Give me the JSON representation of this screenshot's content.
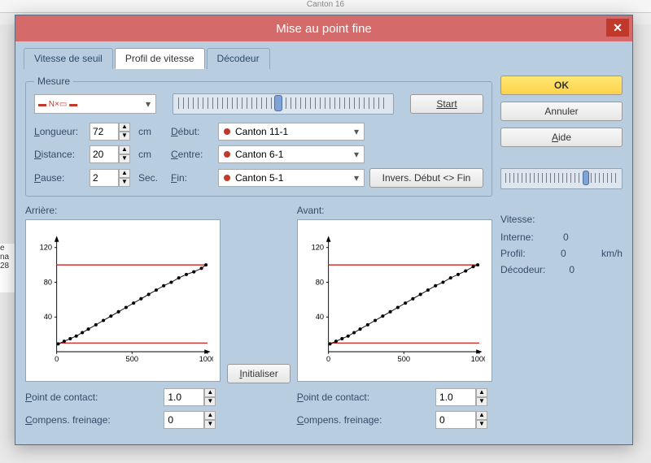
{
  "window": {
    "bg_title": "Canton 16"
  },
  "dialog": {
    "title": "Mise au point fine",
    "close_glyph": "✕",
    "tabs": {
      "threshold": "Vitesse de seuil",
      "profile": "Profil de vitesse",
      "decoder": "Décodeur"
    },
    "measure": {
      "legend": "Mesure",
      "start_btn": "Start",
      "longueur_lbl": "Longueur:",
      "longueur_val": "72",
      "cm": "cm",
      "distance_lbl": "Distance:",
      "distance_val": "20",
      "pause_lbl": "Pause:",
      "pause_val": "2",
      "sec": "Sec.",
      "debut_lbl": "Début:",
      "debut_val": "Canton 11-1",
      "centre_lbl": "Centre:",
      "centre_val": "Canton 6-1",
      "fin_lbl": "Fin:",
      "fin_val": "Canton 5-1",
      "invert_btn": "Invers. Début <> Fin"
    },
    "arriere": {
      "title": "Arrière:",
      "contact_lbl": "Point de contact:",
      "contact_val": "1.0",
      "compens_lbl": "Compens. freinage:",
      "compens_val": "0"
    },
    "avant": {
      "title": "Avant:",
      "contact_lbl": "Point de contact:",
      "contact_val": "1.0",
      "compens_lbl": "Compens. freinage:",
      "compens_val": "0"
    },
    "init_btn": "Initialiser",
    "right": {
      "ok": "OK",
      "annuler": "Annuler",
      "aide": "Aide",
      "vitesse_hdr": "Vitesse:",
      "interne_lbl": "Interne:",
      "interne_val": "0",
      "profil_lbl": "Profil:",
      "profil_val": "0",
      "profil_unit": "km/h",
      "decodeur_lbl": "Décodeur:",
      "decodeur_val": "0"
    }
  },
  "chart_data": [
    {
      "type": "line",
      "title": "Arrière",
      "xlabel": "",
      "ylabel": "",
      "xlim": [
        0,
        1000
      ],
      "ylim": [
        0,
        130
      ],
      "x_ticks": [
        0,
        500,
        1000
      ],
      "y_ticks": [
        40,
        80,
        120
      ],
      "hlines": [
        10,
        100
      ],
      "series": [
        {
          "name": "profile",
          "x": [
            10,
            50,
            90,
            130,
            170,
            210,
            260,
            310,
            360,
            410,
            460,
            510,
            560,
            610,
            660,
            710,
            760,
            810,
            860,
            910,
            960,
            990
          ],
          "y": [
            9,
            12,
            15,
            18,
            22,
            26,
            31,
            36,
            41,
            46,
            51,
            56,
            61,
            66,
            71,
            76,
            80,
            85,
            89,
            92,
            96,
            100
          ]
        }
      ]
    },
    {
      "type": "line",
      "title": "Avant",
      "xlabel": "",
      "ylabel": "",
      "xlim": [
        0,
        1000
      ],
      "ylim": [
        0,
        130
      ],
      "x_ticks": [
        0,
        500,
        1000
      ],
      "y_ticks": [
        40,
        80,
        120
      ],
      "hlines": [
        10,
        100
      ],
      "series": [
        {
          "name": "profile",
          "x": [
            10,
            50,
            90,
            130,
            170,
            210,
            260,
            310,
            360,
            410,
            460,
            510,
            560,
            610,
            660,
            710,
            760,
            810,
            860,
            910,
            960,
            990
          ],
          "y": [
            9,
            12,
            15,
            18,
            22,
            26,
            31,
            36,
            41,
            46,
            51,
            56,
            61,
            66,
            71,
            76,
            80,
            85,
            89,
            93,
            98,
            100
          ]
        }
      ]
    }
  ]
}
